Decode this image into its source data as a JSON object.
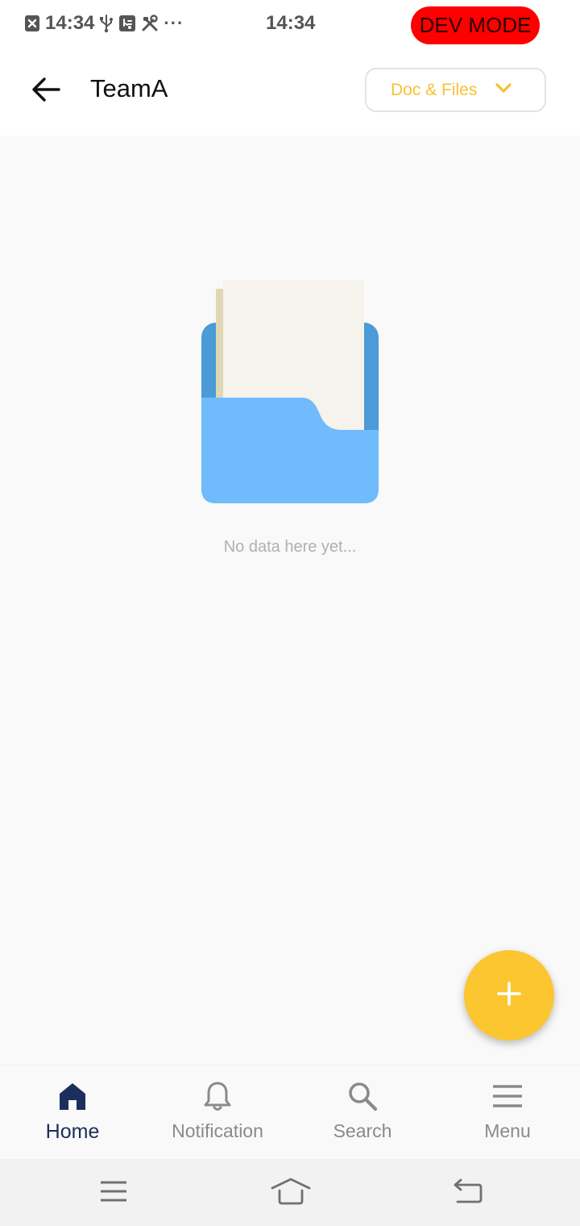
{
  "status_bar": {
    "left_time": "14:34",
    "center_time": "14:34",
    "overflow": "···",
    "dev_badge": "DEV MODE",
    "icons": [
      "notification-x-icon",
      "usb-icon",
      "debug-icon",
      "tools-icon"
    ]
  },
  "header": {
    "title": "TeamA",
    "back_icon": "arrow-left-icon",
    "dropdown_label": "Doc & Files",
    "dropdown_icon": "chevron-down-icon"
  },
  "empty_state": {
    "message": "No data here yet...",
    "icon": "folder-with-document-icon"
  },
  "fab": {
    "icon": "plus-icon"
  },
  "bottom_nav": {
    "items": [
      {
        "label": "Home",
        "icon": "home-icon",
        "active": true
      },
      {
        "label": "Notification",
        "icon": "bell-icon",
        "active": false
      },
      {
        "label": "Search",
        "icon": "search-icon",
        "active": false
      },
      {
        "label": "Menu",
        "icon": "menu-icon",
        "active": false
      }
    ]
  },
  "system_nav": {
    "icons": [
      "recents-icon",
      "home-icon",
      "back-icon"
    ]
  },
  "colors": {
    "accent": "#fcc631",
    "dropdown_text": "#f5c232",
    "nav_active": "#1c2e5c",
    "nav_inactive": "#8a8a8a",
    "dev_badge": "#ff0000",
    "folder_front": "#6fbbfb",
    "folder_back": "#4a9bd6"
  }
}
